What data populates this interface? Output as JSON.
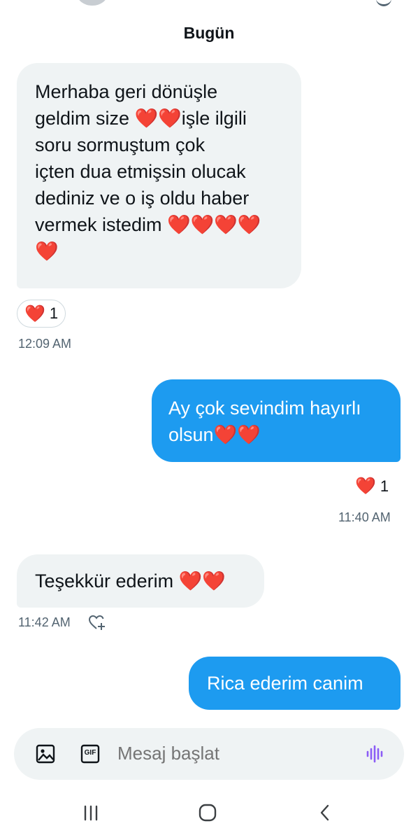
{
  "conversation": {
    "date_divider": "Bugün",
    "messages": [
      {
        "direction": "incoming",
        "text": "Merhaba geri dönüşle\ngeldim size ❤️❤️işle ilgili\nsoru sormuştum çok\niçten dua etmişsin olucak\ndediniz ve o iş oldu haber\nvermek istedim ❤️❤️❤️❤️\n❤️",
        "reaction": {
          "emoji": "❤️",
          "count": "1"
        },
        "time": "12:09 AM"
      },
      {
        "direction": "outgoing",
        "text": "Ay çok sevindim hayırlı\nolsun❤️❤️",
        "reaction": {
          "emoji": "❤️",
          "count": "1"
        },
        "time": "11:40 AM"
      },
      {
        "direction": "incoming",
        "text": "Teşekkür ederim ❤️❤️",
        "time": "11:42 AM",
        "add_reaction_icon": "heart-plus-icon"
      },
      {
        "direction": "outgoing",
        "text": "Rica ederim canim"
      }
    ]
  },
  "composer": {
    "placeholder": "Mesaj başlat",
    "media_icon": "image-icon",
    "gif_label": "GIF",
    "voice_icon": "voice-waveform-icon"
  },
  "navbar": {
    "recents_icon": "recent-apps-icon",
    "home_icon": "home-icon",
    "back_icon": "back-icon"
  },
  "colors": {
    "accent": "#1d9bf0",
    "incoming_bubble": "#eff3f4",
    "voice_icon": "#8b5cf6",
    "heart": "#e0245e",
    "secondary_text": "#536471"
  }
}
